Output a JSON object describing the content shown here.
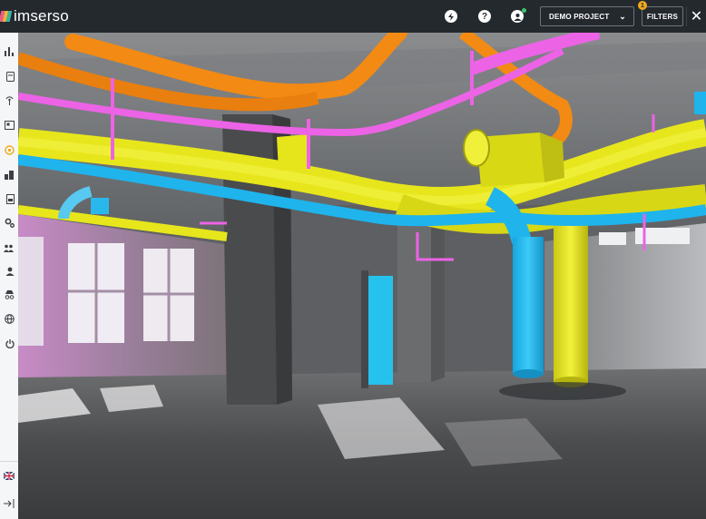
{
  "app": {
    "brand": "imserso"
  },
  "topbar": {
    "project_label": "DEMO PROJECT",
    "filters_label": "FILTERS",
    "filters_count": "1",
    "close_label": "✕",
    "icons": [
      "flash-icon",
      "help-icon",
      "user-icon"
    ]
  },
  "sidebar": {
    "items": [
      {
        "name": "analytics-icon",
        "glyph": "ılı"
      },
      {
        "name": "documents-icon",
        "glyph": "▢"
      },
      {
        "name": "sensors-icon",
        "glyph": "⊕"
      },
      {
        "name": "gallery-icon",
        "glyph": "▣"
      },
      {
        "name": "viewer-icon",
        "glyph": "◎",
        "active": true
      },
      {
        "name": "buildings-icon",
        "glyph": "▟"
      },
      {
        "name": "reports-icon",
        "glyph": "▤"
      },
      {
        "name": "settings-icon",
        "glyph": "⚙"
      },
      {
        "name": "team-icon",
        "glyph": "⁂"
      },
      {
        "name": "profile-icon",
        "glyph": "●"
      },
      {
        "name": "anonymous-icon",
        "glyph": "⌓"
      },
      {
        "name": "globe-icon",
        "glyph": "⊕"
      },
      {
        "name": "power-icon",
        "glyph": "⏻"
      },
      {
        "name": "language-flag-icon",
        "glyph": "⊠"
      },
      {
        "name": "collapse-icon",
        "glyph": "→|"
      }
    ]
  },
  "colors": {
    "topbar": "#24292e",
    "accent": "#f0a81c",
    "pipe_orange": "#f28a14",
    "pipe_magenta": "#ec63e6",
    "pipe_yellow": "#e7e61c",
    "pipe_cyan": "#1fb4ec"
  }
}
